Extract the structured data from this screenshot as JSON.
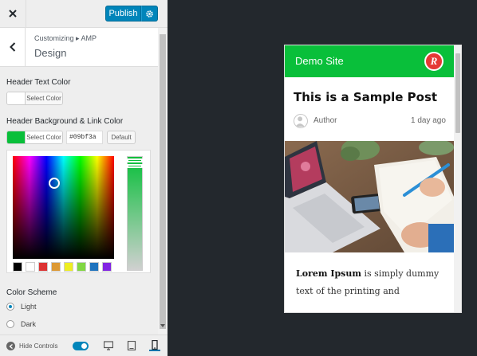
{
  "topbar": {
    "publish_label": "Publish",
    "close_icon": "close-icon",
    "gear_icon": "gear-icon"
  },
  "section": {
    "breadcrumb": "Customizing ▸ AMP",
    "title": "Design"
  },
  "controls": {
    "header_text_color": {
      "label": "Header Text Color",
      "button_label": "Select Color",
      "color": "#ffffff"
    },
    "header_bg_link_color": {
      "label": "Header Background & Link Color",
      "button_label": "Select Color",
      "color": "#09bf3a",
      "hex_value": "#09bf3a",
      "default_label": "Default"
    },
    "palette": [
      "#000000",
      "#ffffff",
      "#dd3333",
      "#dd9933",
      "#eeee22",
      "#81d742",
      "#1e73be",
      "#8224e3"
    ],
    "color_scheme": {
      "label": "Color Scheme",
      "options": [
        {
          "label": "Light",
          "selected": true
        },
        {
          "label": "Dark",
          "selected": false
        }
      ]
    }
  },
  "footer": {
    "hide_controls_label": "Hide Controls",
    "devices": [
      "desktop",
      "tablet",
      "mobile"
    ],
    "active_device": "mobile"
  },
  "preview": {
    "site_title": "Demo Site",
    "logo_letter": "R",
    "post_title": "This is a Sample Post",
    "author": "Author",
    "date": "1 day ago",
    "body_lead": "Lorem Ipsum",
    "body_line1": " is simply dummy",
    "body_line2": "text of the printing and"
  },
  "colors": {
    "accent": "#0085ba",
    "header_bg": "#09bf3a",
    "admin_dark": "#23282d"
  }
}
